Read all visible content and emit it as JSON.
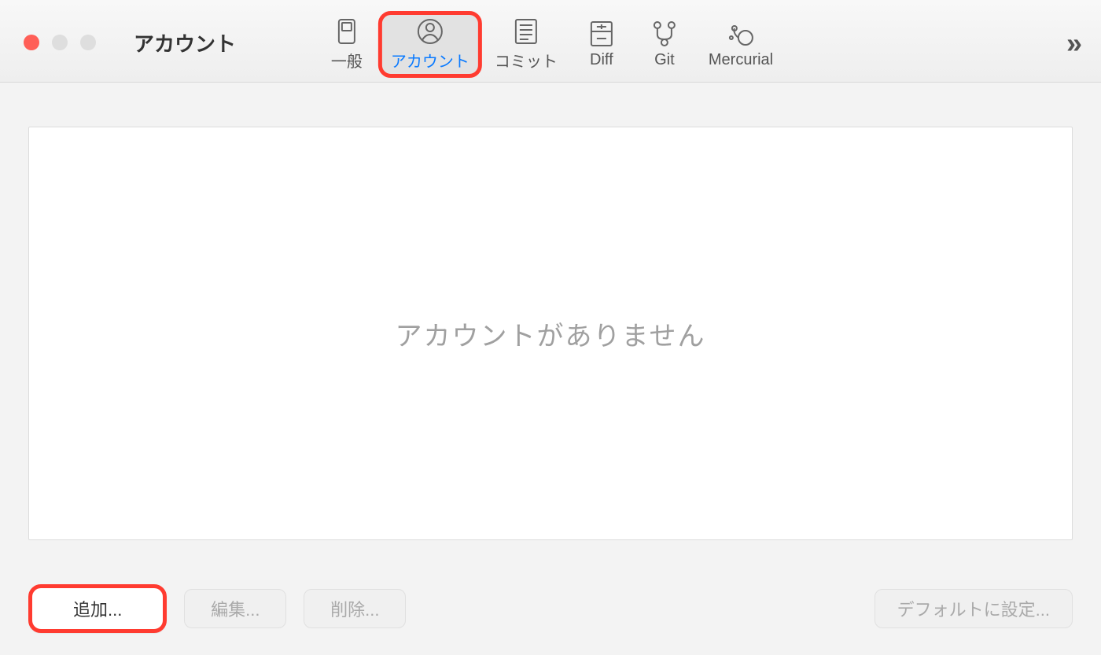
{
  "window": {
    "title": "アカウント"
  },
  "toolbar": {
    "tabs": [
      {
        "label": "一般",
        "icon": "general-icon"
      },
      {
        "label": "アカウント",
        "icon": "account-icon"
      },
      {
        "label": "コミット",
        "icon": "commit-icon"
      },
      {
        "label": "Diff",
        "icon": "diff-icon"
      },
      {
        "label": "Git",
        "icon": "git-icon"
      },
      {
        "label": "Mercurial",
        "icon": "mercurial-icon"
      }
    ]
  },
  "main": {
    "empty_message": "アカウントがありません"
  },
  "buttons": {
    "add": "追加...",
    "edit": "編集...",
    "delete": "削除...",
    "set_default": "デフォルトに設定..."
  },
  "highlights": {
    "color": "#ff3b30"
  }
}
